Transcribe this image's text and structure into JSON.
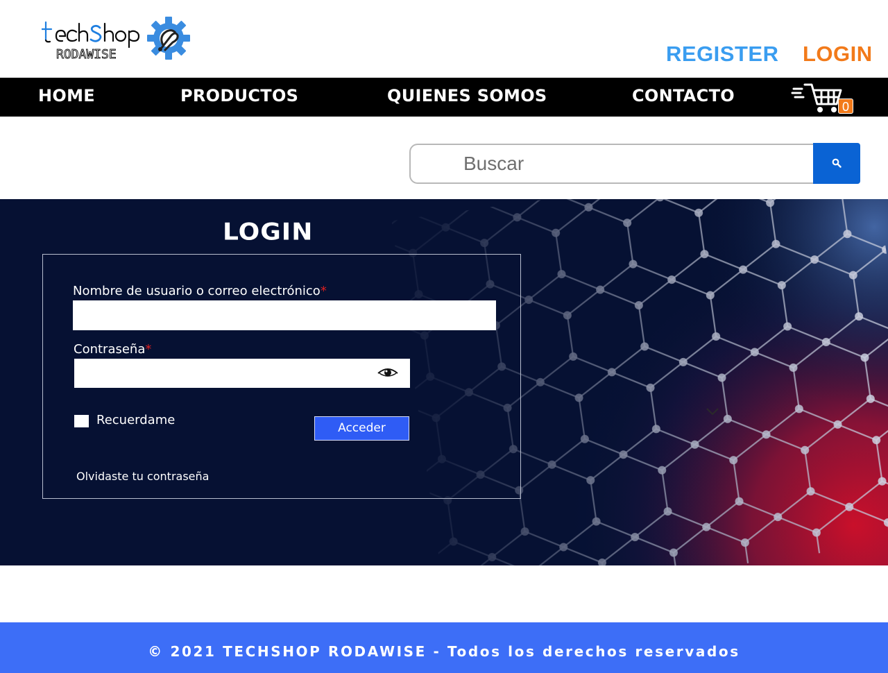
{
  "header": {
    "logo": {
      "line1": "techShop",
      "line2": "RODAWISE"
    },
    "register_label": "REGISTER",
    "login_label": "LOGIN"
  },
  "nav": {
    "items": [
      {
        "label": "HOME"
      },
      {
        "label": "PRODUCTOS"
      },
      {
        "label": "QUIENES SOMOS"
      },
      {
        "label": "CONTACTO"
      }
    ],
    "cart_count": "0",
    "cart_icon": "shopping-cart-icon"
  },
  "search": {
    "placeholder": "Buscar",
    "value": "",
    "button_icon": "search-icon"
  },
  "login_form": {
    "heading": "LOGIN",
    "username_label": "Nombre de usuario o correo electrónico",
    "password_label": "Contraseña",
    "required_mark": "*",
    "username_value": "",
    "password_value": "",
    "remember_label": "Recuerdame",
    "remember_checked": false,
    "submit_label": "Acceder",
    "forgot_label": "Olvidaste tu contraseña",
    "password_toggle_icon": "eye-icon"
  },
  "footer": {
    "text": "© 2021 TECHSHOP RODAWISE - Todos los derechos reservados"
  },
  "colors": {
    "register": "#3a9df0",
    "login": "#f27a1a",
    "nav_bg": "#000000",
    "search_button": "#0a63d4",
    "hero_bg": "#061133",
    "submit_button": "#2f5cf5",
    "footer_bg": "#3d6ef7",
    "required": "#e02020"
  }
}
